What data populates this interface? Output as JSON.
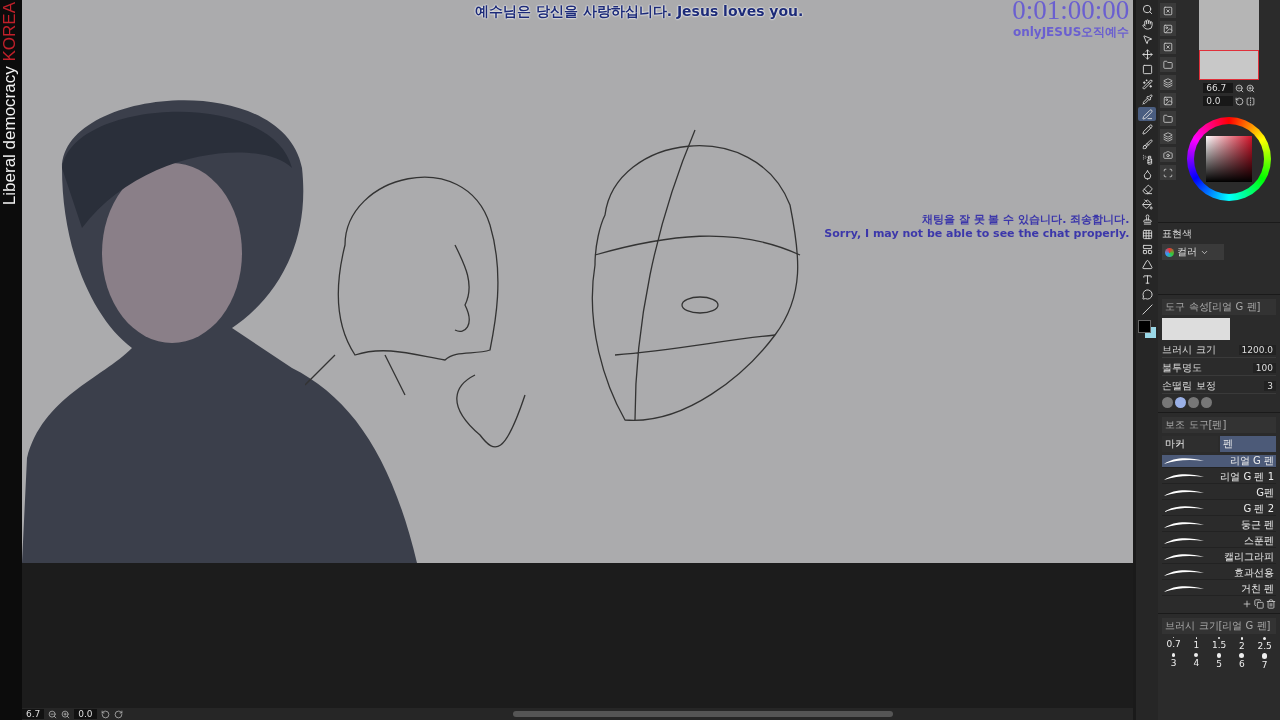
{
  "side_banner": {
    "text": "Liberal democracy",
    "highlight": "KOREA"
  },
  "overlay": {
    "message": "예수님은 당신을 사랑하십니다. Jesus loves you.",
    "timer": "0:01:00:00",
    "channel": "onlyJESUS오직예수",
    "chat_notice_ko": "채팅을 잘 못 볼 수 있습니다. 죄송합니다.",
    "chat_notice_en": "Sorry, I may not be able to see the chat properly."
  },
  "toolbar": [
    {
      "kind": "zoom",
      "selected": false
    },
    {
      "kind": "hand",
      "selected": false
    },
    {
      "kind": "object",
      "selected": false
    },
    {
      "kind": "move",
      "selected": false
    },
    {
      "kind": "marquee",
      "selected": false
    },
    {
      "kind": "wand",
      "selected": false
    },
    {
      "kind": "eyedropper",
      "selected": false
    },
    {
      "kind": "pen",
      "selected": true
    },
    {
      "kind": "pencil",
      "selected": false
    },
    {
      "kind": "brush",
      "selected": false
    },
    {
      "kind": "spray",
      "selected": false
    },
    {
      "kind": "blend",
      "selected": false
    },
    {
      "kind": "eraser",
      "selected": false
    },
    {
      "kind": "fill",
      "selected": false
    },
    {
      "kind": "stamp",
      "selected": false
    },
    {
      "kind": "grid",
      "selected": false
    },
    {
      "kind": "frame",
      "selected": false
    },
    {
      "kind": "ruler",
      "selected": false
    },
    {
      "kind": "text",
      "selected": false
    },
    {
      "kind": "balloon",
      "selected": false
    },
    {
      "kind": "line",
      "selected": false
    }
  ],
  "navigator": {
    "zoom": "66.7",
    "angle": "0.0"
  },
  "color": {
    "label": "표현색",
    "mode": "컬러"
  },
  "tool_property": {
    "title": "도구 속성[리얼 G 펜]",
    "antialias": [
      {
        "selected": false
      },
      {
        "selected": true
      },
      {
        "selected": false
      },
      {
        "selected": false
      }
    ],
    "rows": [
      {
        "label": "브러시 크기",
        "value": "1200.0"
      },
      {
        "label": "불투명도",
        "value": "100"
      },
      {
        "label": "손떨림 보정",
        "value": "3"
      }
    ]
  },
  "sub_tool": {
    "title": "보조 도구[펜]",
    "tabs": [
      {
        "label": "마커",
        "selected": false
      },
      {
        "label": "펜",
        "selected": true
      }
    ],
    "items": [
      {
        "label": "리얼 G 펜",
        "selected": true
      },
      {
        "label": "리얼 G 펜 1",
        "selected": false
      },
      {
        "label": "G펜",
        "selected": false
      },
      {
        "label": "G 펜 2",
        "selected": false
      },
      {
        "label": "둥근 펜",
        "selected": false
      },
      {
        "label": "스푼펜",
        "selected": false
      },
      {
        "label": "캘리그라피",
        "selected": false
      },
      {
        "label": "효과선용",
        "selected": false
      },
      {
        "label": "거친 펜",
        "selected": false
      }
    ]
  },
  "brush_size": {
    "title": "브러시 크기[리얼 G 펜]",
    "sizes": [
      "0.7",
      "1",
      "1.5",
      "2",
      "2.5",
      "3",
      "4",
      "5",
      "6",
      "7"
    ]
  },
  "status_bar": {
    "zoom": "6.7",
    "angle": "0.0"
  }
}
